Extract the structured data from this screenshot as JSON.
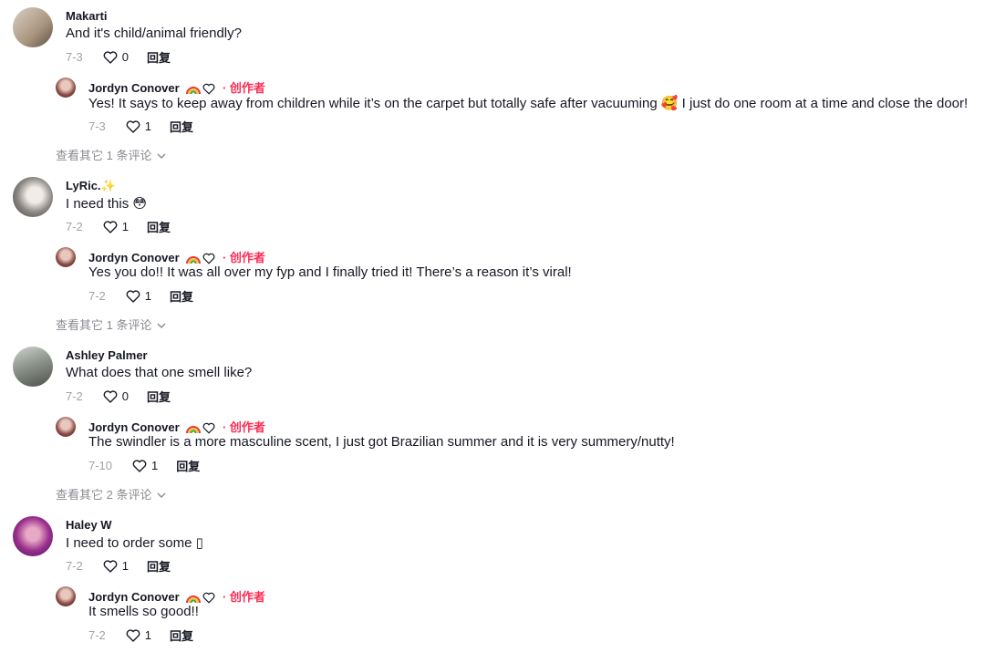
{
  "comments": [
    {
      "user": "Makarti",
      "text": "And it's child/animal friendly?",
      "date": "7-3",
      "likes": "0",
      "reply_label": "回复",
      "reply": {
        "user": "Jordyn Conover",
        "creator_label": "· 创作者",
        "text": "Yes! It says to keep away from children while it’s on the carpet but totally safe after vacuuming 🥰 I just do one room at a time and close the door!",
        "date": "7-3",
        "likes": "1",
        "reply_label": "回复"
      },
      "more": "查看其它 1 条评论"
    },
    {
      "user": "LyRic.✨",
      "text": "I need this 😳",
      "date": "7-2",
      "likes": "1",
      "reply_label": "回复",
      "reply": {
        "user": "Jordyn Conover",
        "creator_label": "· 创作者",
        "text": "Yes you do!! It was all over my fyp and I finally tried it! There’s a reason it’s viral!",
        "date": "7-2",
        "likes": "1",
        "reply_label": "回复"
      },
      "more": "查看其它 1 条评论"
    },
    {
      "user": "Ashley Palmer",
      "text": "What does that one smell like?",
      "date": "7-2",
      "likes": "0",
      "reply_label": "回复",
      "reply": {
        "user": "Jordyn Conover",
        "creator_label": "· 创作者",
        "text": "The swindler is a more masculine scent, I just got Brazilian summer and it is very summery/nutty!",
        "date": "7-10",
        "likes": "1",
        "reply_label": "回复"
      },
      "more": "查看其它 2 条评论"
    },
    {
      "user": "Haley W",
      "text": "I need to order some ▯",
      "date": "7-2",
      "likes": "1",
      "reply_label": "回复",
      "reply": {
        "user": "Jordyn Conover",
        "creator_label": "· 创作者",
        "text": "It smells so good!!",
        "date": "7-2",
        "likes": "1",
        "reply_label": "回复"
      }
    }
  ],
  "colors": {
    "creator": "#fe2c55",
    "meta": "#8a8b91",
    "text": "#161823"
  }
}
